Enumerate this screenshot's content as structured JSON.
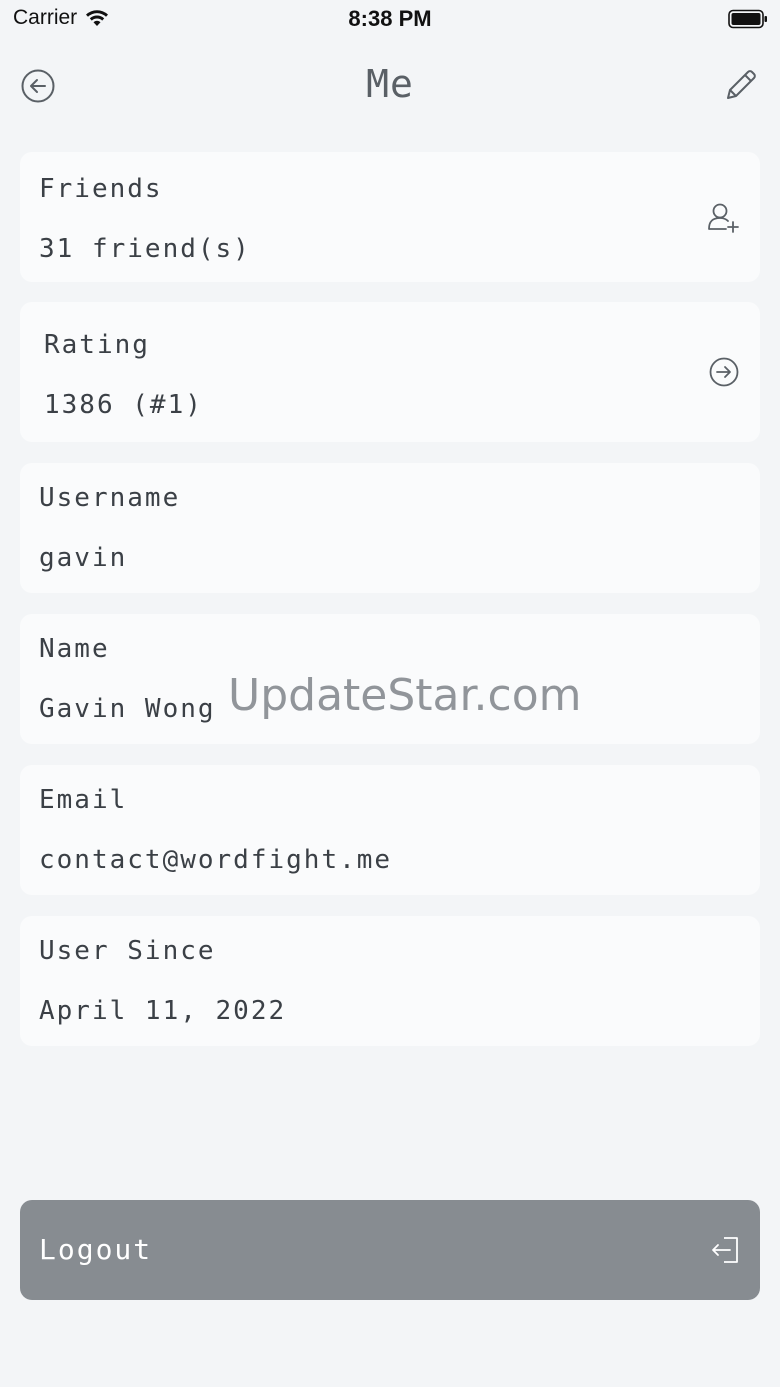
{
  "status_bar": {
    "carrier": "Carrier",
    "time": "8:38 PM"
  },
  "nav": {
    "title": "Me"
  },
  "friends": {
    "label": "Friends",
    "value": "31 friend(s)"
  },
  "rating": {
    "label": "Rating",
    "value": "1386 (#1)"
  },
  "username": {
    "label": "Username",
    "value": "gavin"
  },
  "name": {
    "label": "Name",
    "value": "Gavin Wong"
  },
  "email": {
    "label": "Email",
    "value": "contact@wordfight.me"
  },
  "user_since": {
    "label": "User Since",
    "value": "April 11, 2022"
  },
  "logout": {
    "label": "Logout"
  },
  "watermark": "UpdateStar.com",
  "icons": {
    "back": "arrow-left-circle-icon",
    "edit": "pencil-icon",
    "add_friend": "user-plus-icon",
    "rating_go": "arrow-right-circle-icon",
    "logout": "log-out-icon"
  }
}
